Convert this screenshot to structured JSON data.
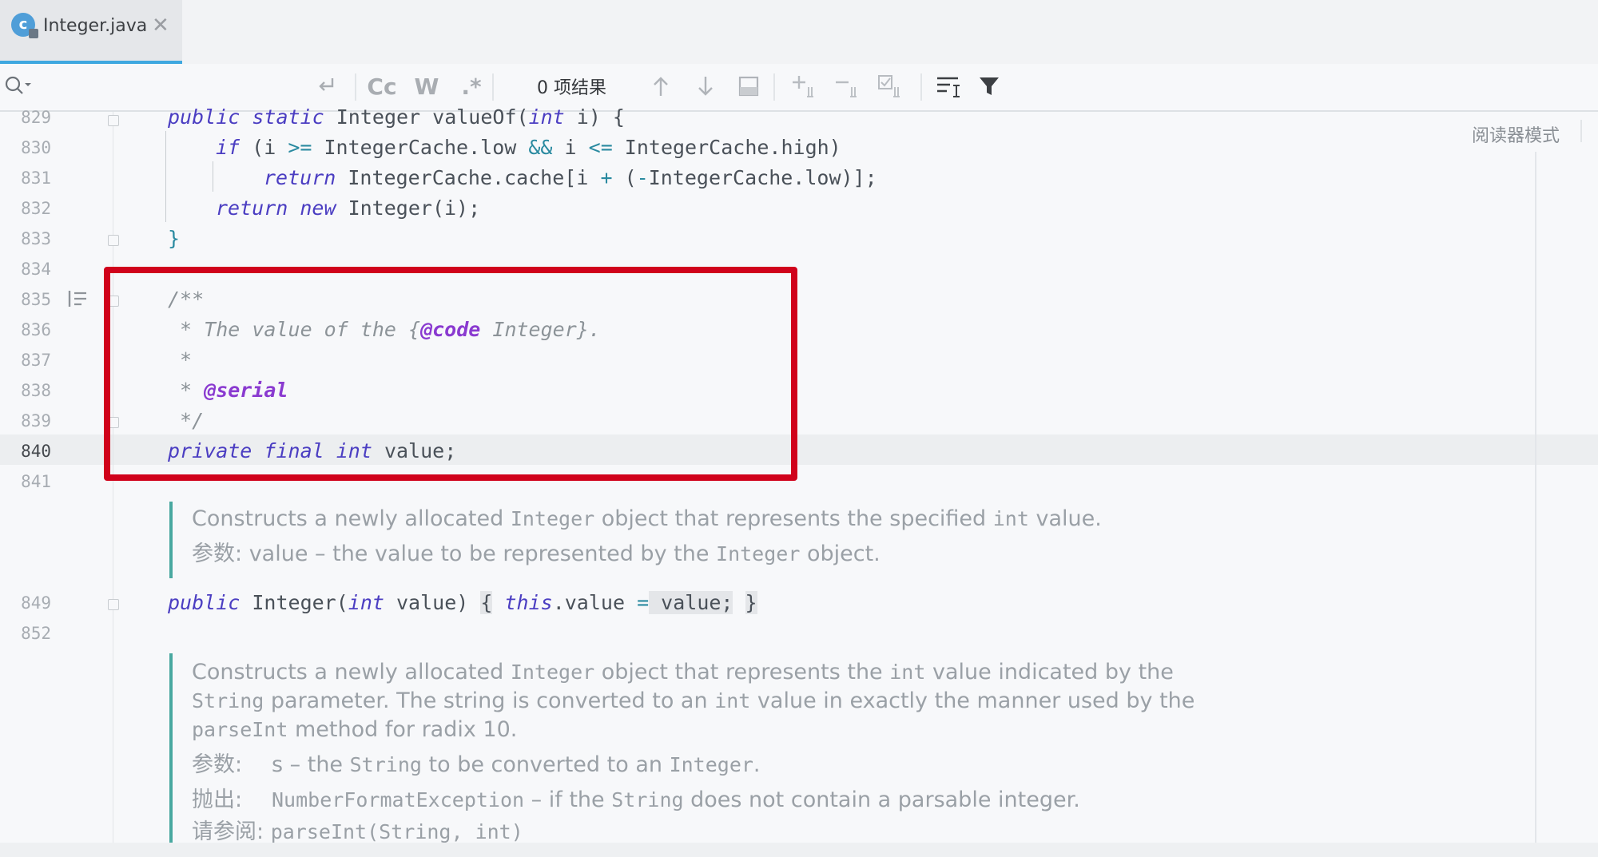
{
  "tab": {
    "icon_letter": "c",
    "filename": "Integer.java",
    "close_glyph": "✕"
  },
  "find": {
    "case_label": "Cc",
    "word_label": "W",
    "regex_label": ".*",
    "result_count": "0 项结果"
  },
  "reader_mode": "阅读器模式",
  "line_numbers": {
    "l829": "829",
    "l830": "830",
    "l831": "831",
    "l832": "832",
    "l833": "833",
    "l834": "834",
    "l835": "835",
    "l836": "836",
    "l837": "837",
    "l838": "838",
    "l839": "839",
    "l840": "840",
    "l841": "841",
    "l849": "849",
    "l852": "852"
  },
  "code": {
    "l829": {
      "k1": "public",
      "k2": "static",
      "t1": " Integer valueOf(",
      "k3": "int",
      "t2": " i) {"
    },
    "l830": {
      "k1": "if",
      "t1": " (i ",
      "o1": ">=",
      "t2": " IntegerCache.low ",
      "o2": "&&",
      "t3": " i ",
      "o3": "<=",
      "t4": " IntegerCache.high)"
    },
    "l831": {
      "k1": "return",
      "t1": " IntegerCache.cache[i ",
      "o1": "+",
      "t2": " (",
      "o2": "-",
      "t3": "IntegerCache.low)];"
    },
    "l832": {
      "k1": "return",
      "k2": "new",
      "t1": " Integer(i);"
    },
    "l833": {
      "t1": "}"
    },
    "l835": {
      "c1": "/**"
    },
    "l836": {
      "c1": " * The value of the {",
      "tag": "@code",
      "c2": " Integer}."
    },
    "l837": {
      "c1": " *"
    },
    "l838": {
      "c1": " * ",
      "tag": "@serial"
    },
    "l839": {
      "c1": " */"
    },
    "l840": {
      "k1": "private",
      "k2": "final",
      "k3": "int",
      "t1": " value;"
    },
    "l849": {
      "k1": "public",
      "t1": " Integer(",
      "k2": "int",
      "t2": " value) ",
      "t3": "{",
      "k3": "this",
      "t4": ".value ",
      "o1": "=",
      "t5": " value;",
      "t6": "}"
    }
  },
  "doc1": {
    "p1": "Constructs a newly allocated ",
    "m1": "Integer",
    "p2": " object that represents the specified ",
    "m2": "int",
    "p3": " value.",
    "param_label": "参数:",
    "param_text": " value – the value to be represented by the ",
    "param_mono": "Integer",
    "param_end": " object."
  },
  "doc2": {
    "a1": "Constructs a newly allocated ",
    "a2": "Integer",
    "a3": " object that represents the ",
    "a4": "int",
    "a5": " value indicated by the",
    "b1": "String",
    "b2": " parameter. The string is converted to an ",
    "b3": "int",
    "b4": " value in exactly the manner used by the",
    "c1": "parseInt",
    "c2": " method for radix 10.",
    "param_label": "参数:",
    "param_text": "s – the ",
    "param_mono1": "String",
    "param_text2": " to be converted to an ",
    "param_mono2": "Integer",
    "param_end": ".",
    "throws_label": "抛出:",
    "throws_mono": "NumberFormatException",
    "throws_text": " – if the ",
    "throws_mono2": "String",
    "throws_end": " does not contain a parsable integer.",
    "see_label": "请参阅:",
    "see_mono": "parseInt(String, int)"
  },
  "colors": {
    "accent": "#3fa8e0",
    "highlight_box": "#d0021b",
    "doc_bar": "#49a8a0"
  }
}
